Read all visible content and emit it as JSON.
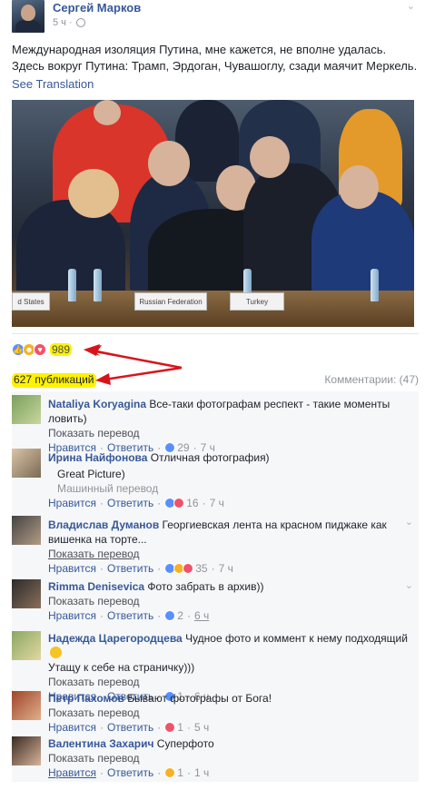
{
  "post": {
    "author": "Сергей Марков",
    "time": "5 ч ·",
    "text_line1": "Международная изоляция Путина, мне кажется, не вполне удалась.",
    "text_line2": "Здесь вокруг Путина: Трамп, Эрдоган, Чувашоглу, сзади маячит Меркель.",
    "see_translation": "See Translation",
    "plate_1": "d States",
    "plate_2": "Russian Federation",
    "plate_3": "Turkey"
  },
  "reactions": {
    "count": "989",
    "shares": "627 публикаций",
    "comments_label": "Комментарии: (47)"
  },
  "comments": [
    {
      "name": "Nataliya Koryagina",
      "text": " Все-таки фотографам респект - такие моменты ловить)",
      "show_translation": "Показать перевод",
      "like": "Нравится",
      "reply": "Ответить",
      "reaction_count": "29",
      "time": "7 ч"
    },
    {
      "name": "Ирина Найфонова",
      "text": " Отличная фотография)",
      "translation": "Great Picture)",
      "machine": "Машинный перевод",
      "like": "Нравится",
      "reply": "Ответить",
      "reaction_count": "16",
      "time": "7 ч"
    },
    {
      "name": "Владислав Думанов",
      "text": " Георгиевская лента на красном пиджаке как вишенка на торте...",
      "show_translation": "Показать перевод",
      "like": "Нравится",
      "reply": "Ответить",
      "reaction_count": "35",
      "time": "7 ч"
    },
    {
      "name": "Rimma Denisevica",
      "text": " Фото забрать в архив))",
      "show_translation": "Показать перевод",
      "like": "Нравится",
      "reply": "Ответить",
      "reaction_count": "2",
      "time": "6 ч"
    },
    {
      "name": "Надежда Царегородцева",
      "text": " Чудное фото и коммент к нему подходящий",
      "text2": "Утащу к себе на страничку)))",
      "show_translation": "Показать перевод",
      "like": "Нравится",
      "reply": "Ответить",
      "reaction_count": "1",
      "time": "6 ч"
    },
    {
      "name": "Петр Пахомов",
      "text": " Бывают фотографы от Бога!",
      "show_translation": "Показать перевод",
      "like": "Нравится",
      "reply": "Ответить",
      "reaction_count": "1",
      "time": "5 ч"
    },
    {
      "name": "Валентина Захарич",
      "text": " Суперфото",
      "show_translation": "Показать перевод",
      "like": "Нравится",
      "reply": "Ответить",
      "reaction_count": "1",
      "time": "1 ч"
    }
  ],
  "colors": {
    "link": "#365899",
    "highlight": "#fff200",
    "arrow": "#d8141b",
    "like": "#5890ff",
    "haha": "#f7b125",
    "love": "#f25268"
  }
}
